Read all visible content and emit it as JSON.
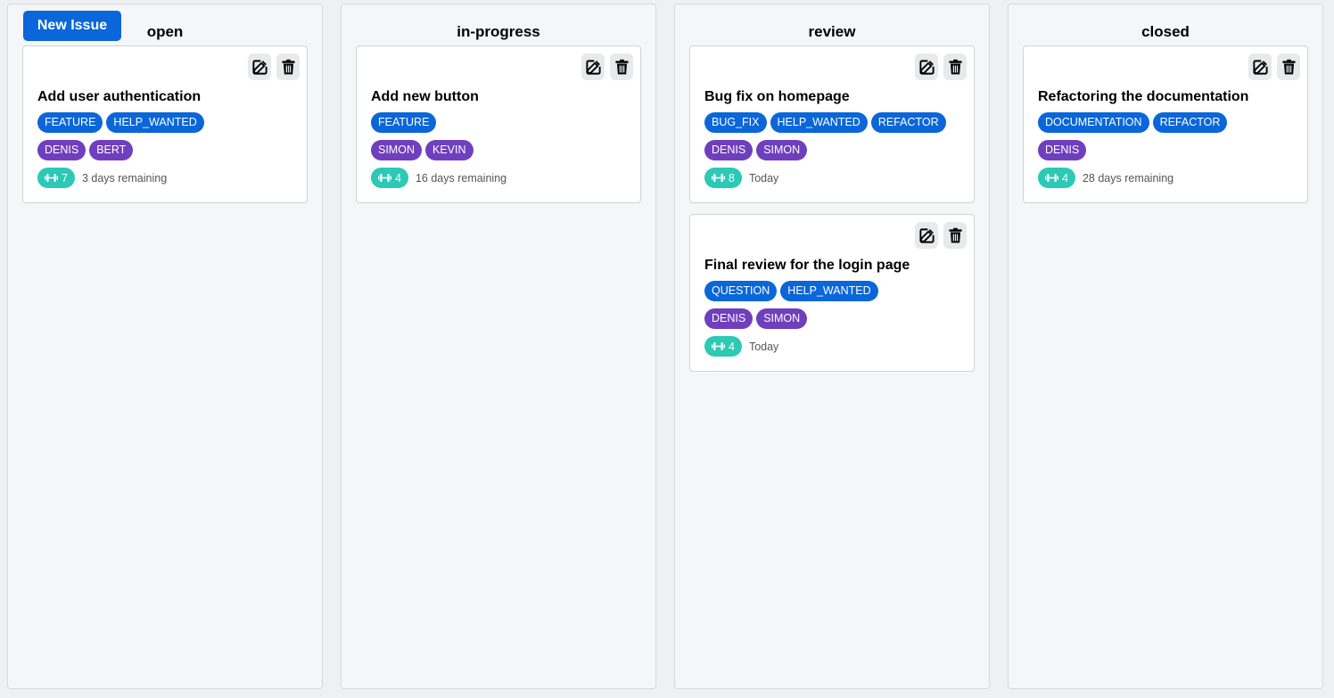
{
  "toolbar": {
    "new_issue_label": "New Issue"
  },
  "columns": [
    {
      "title": "open",
      "cards": [
        {
          "title": "Add user authentication",
          "labels": [
            "FEATURE",
            "HELP_WANTED"
          ],
          "assignees": [
            "DENIS",
            "BERT"
          ],
          "weight": "7",
          "due": "3 days remaining"
        }
      ]
    },
    {
      "title": "in-progress",
      "cards": [
        {
          "title": "Add new button",
          "labels": [
            "FEATURE"
          ],
          "assignees": [
            "SIMON",
            "KEVIN"
          ],
          "weight": "4",
          "due": "16 days remaining"
        }
      ]
    },
    {
      "title": "review",
      "cards": [
        {
          "title": "Bug fix on homepage",
          "labels": [
            "BUG_FIX",
            "HELP_WANTED",
            "REFACTOR"
          ],
          "assignees": [
            "DENIS",
            "SIMON"
          ],
          "weight": "8",
          "due": "Today"
        },
        {
          "title": "Final review for the login page",
          "labels": [
            "QUESTION",
            "HELP_WANTED"
          ],
          "assignees": [
            "DENIS",
            "SIMON"
          ],
          "weight": "4",
          "due": "Today"
        }
      ]
    },
    {
      "title": "closed",
      "cards": [
        {
          "title": "Refactoring the documentation",
          "labels": [
            "DOCUMENTATION",
            "REFACTOR"
          ],
          "assignees": [
            "DENIS"
          ],
          "weight": "4",
          "due": "28 days remaining"
        }
      ]
    }
  ],
  "icons": {
    "edit": "edit-icon",
    "delete": "trash-icon",
    "weight": "dumbbell-icon"
  },
  "colors": {
    "primary": "#0a66d9",
    "label": "#0a66d9",
    "assignee": "#6f3fbd",
    "weight": "#2cc9b5"
  }
}
